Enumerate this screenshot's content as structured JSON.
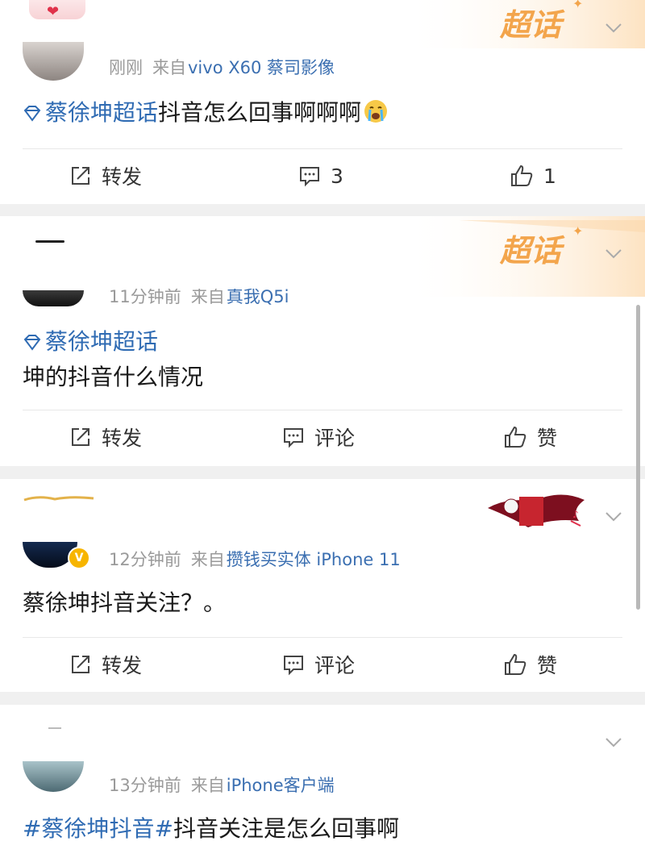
{
  "posts": [
    {
      "time": "刚刚",
      "from_prefix": "来自",
      "source": "vivo X60 蔡司影像",
      "topic": "蔡徐坤超话",
      "text": "抖音怎么回事啊啊啊",
      "emoji": "crying-emoji",
      "actions": {
        "repost": "转发",
        "comment": "3",
        "like": "1"
      },
      "banner_text": "超话"
    },
    {
      "time": "11分钟前",
      "from_prefix": "来自",
      "source": "真我Q5i",
      "topic": "蔡徐坤超话",
      "text": "坤的抖音什么情况",
      "actions": {
        "repost": "转发",
        "comment": "评论",
        "like": "赞"
      },
      "banner_text": "超话"
    },
    {
      "time": "12分钟前",
      "from_prefix": "来自",
      "source": "攒钱买实体 iPhone 11",
      "text": "蔡徐坤抖音关注？。",
      "verified_badge": "V",
      "actions": {
        "repost": "转发",
        "comment": "评论",
        "like": "赞"
      }
    },
    {
      "time": "13分钟前",
      "from_prefix": "来自",
      "source": "iPhone客户端",
      "topic": "#蔡徐坤抖音#",
      "text": "抖音关注是怎么回事啊"
    }
  ],
  "colors": {
    "topic_blue": "#2f6bb3",
    "source_blue": "#3b6fb1",
    "meta_gray": "#9a9a9a",
    "banner_orange": "#f0a24a",
    "page_bg": "#f0f0f0"
  }
}
